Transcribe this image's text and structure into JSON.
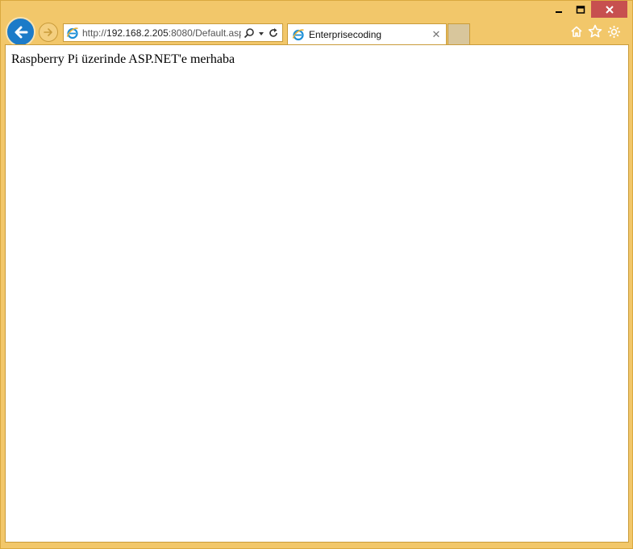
{
  "window": {
    "caption_buttons": [
      "minimize",
      "maximize",
      "close"
    ]
  },
  "toolbar": {
    "back_icon": "back-arrow-icon",
    "forward_icon": "forward-arrow-icon",
    "address": {
      "scheme": "http://",
      "host": "192.168.2.205",
      "rest": ":8080/Default.asp"
    },
    "right_icons": [
      "home-icon",
      "favorites-star-icon",
      "settings-gear-icon"
    ]
  },
  "tabs": [
    {
      "title": "Enterprisecoding",
      "active": true
    }
  ],
  "page": {
    "text": "Raspberry Pi üzerinde ASP.NET'e merhaba"
  },
  "colors": {
    "frame": "#f2c76a",
    "close_button": "#c7504f",
    "back_button": "#1c7bc8"
  }
}
